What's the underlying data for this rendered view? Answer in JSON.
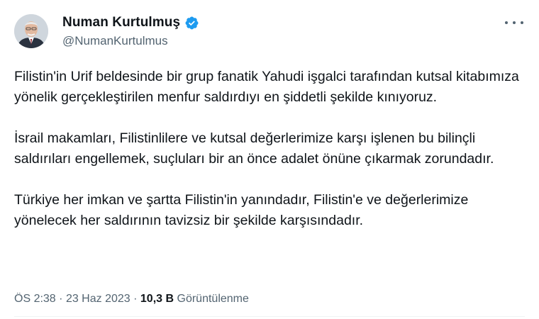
{
  "author": {
    "name": "Numan Kurtulmuş",
    "handle": "@NumanKurtulmus"
  },
  "icons": {
    "avatar": "profile-photo",
    "verified": "verified-badge-icon",
    "more": "more-options-icon"
  },
  "colors": {
    "verified": "#1d9bf0",
    "secondary_text": "#536471",
    "primary_text": "#0f1419"
  },
  "tweet": {
    "paragraphs": [
      "Filistin'in Urif beldesinde bir grup fanatik Yahudi işgalci tarafından kutsal kitabımıza yönelik gerçekleştirilen menfur saldırdıyı en şiddetli şekilde kınıyoruz.",
      "İsrail makamları, Filistinlilere ve kutsal değerlerimize karşı işlenen bu bilinçli saldırıları engellemek, suçluları bir an önce adalet önüne çıkarmak zorundadır.",
      "Türkiye her imkan ve şartta Filistin'in yanındadır, Filistin'e ve değerlerimize yönelecek her saldırının tavizsiz bir şekilde karşısındadır."
    ]
  },
  "meta": {
    "time": "ÖS 2:38",
    "separator": "·",
    "date": "23 Haz 2023",
    "views_count": "10,3 B",
    "views_label": "Görüntülenme"
  }
}
